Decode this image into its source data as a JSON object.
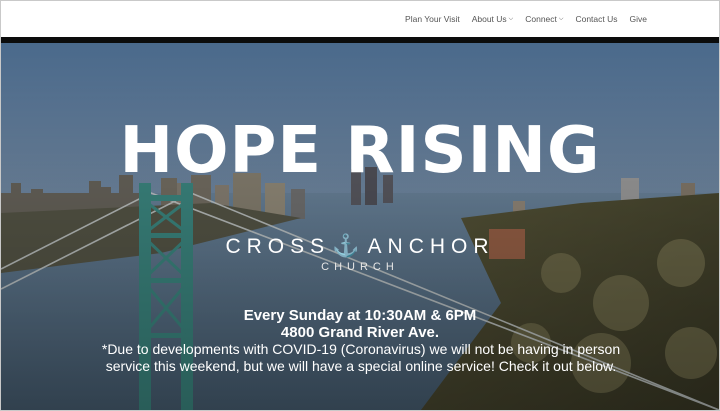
{
  "nav": {
    "items": [
      {
        "label": "Plan Your Visit",
        "dropdown": false
      },
      {
        "label": "About Us",
        "dropdown": true
      },
      {
        "label": "Connect",
        "dropdown": true
      },
      {
        "label": "Contact Us",
        "dropdown": false
      },
      {
        "label": "Give",
        "dropdown": false
      }
    ]
  },
  "hero": {
    "title": "HOPE RISING",
    "logo_left": "CROSS",
    "logo_right": "ANCHOR",
    "logo_sub": "CHURCH",
    "service_time": "Every Sunday at 10:30AM & 6PM",
    "address": "4800 Grand River Ave.",
    "notice": "*Due to developments with COVID-19 (Coronavirus) we will not be having in person service this weekend, but we will have a special online service! Check it out below."
  },
  "colors": {
    "sky": "#8aa0b8",
    "water": "#5f7a92",
    "bridge": "#3f8f88"
  }
}
